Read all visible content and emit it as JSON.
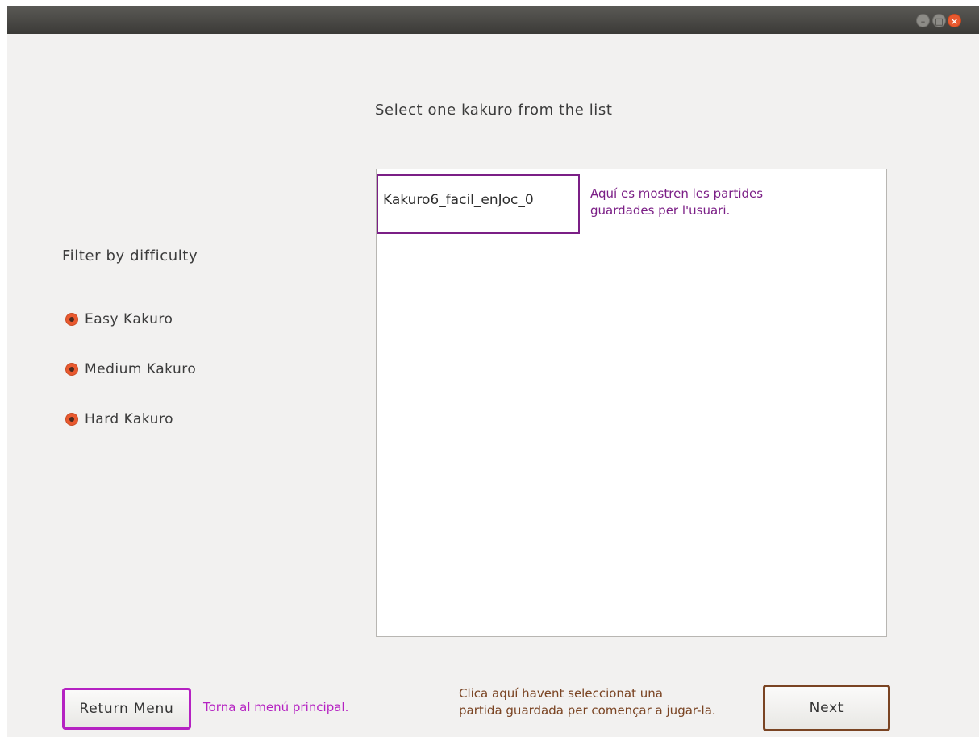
{
  "window": {
    "controls": {
      "minimize_icon": "minimize-icon",
      "maximize_icon": "maximize-icon",
      "close_icon": "close-icon"
    }
  },
  "main": {
    "heading": "Select one kakuro from the list",
    "list": {
      "items": [
        "Kakuro6_facil_enJoc_0"
      ],
      "annotation_line1": "Aquí es mostren les partides",
      "annotation_line2": "guardades per l'usuari."
    }
  },
  "filter": {
    "title": "Filter by difficulty",
    "options": [
      {
        "label": "Easy Kakuro",
        "selected": true
      },
      {
        "label": "Medium Kakuro",
        "selected": true
      },
      {
        "label": "Hard Kakuro",
        "selected": true
      }
    ]
  },
  "footer": {
    "return_button": "Return Menu",
    "return_annotation": "Torna al menú principal.",
    "next_annotation_line1": "Clica aquí havent seleccionat una",
    "next_annotation_line2": "partida guardada per començar a jugar-la.",
    "next_button": "Next"
  },
  "colors": {
    "accent_radio": "#e9592f",
    "annotation_purple": "#7b1f86",
    "annotation_magenta": "#b522c2",
    "annotation_brown": "#7a4423"
  }
}
